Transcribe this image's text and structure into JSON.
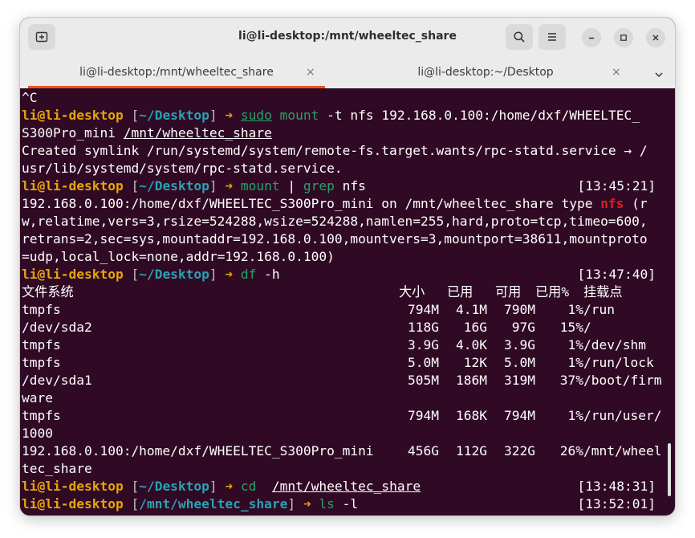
{
  "window": {
    "title": "li@li-desktop:/mnt/wheeltec_share"
  },
  "tabs": [
    {
      "label": "li@li-desktop:/mnt/wheeltec_share",
      "close": "×",
      "active": true
    },
    {
      "label": "li@li-desktop:~/Desktop",
      "close": "×",
      "active": false
    }
  ],
  "colors": {
    "accent": "#e95420",
    "terminal_bg": "#300a24",
    "prompt_user": "#e5a50a",
    "prompt_path": "#2aa1b3",
    "command": "#26a269"
  },
  "terminal": {
    "lines": [
      {
        "t": "^C"
      },
      {
        "user": "li@li-desktop",
        "open": " [",
        "path": "~/Desktop",
        "close": "]",
        "arrow": " ➜ ",
        "cmd": "sudo mount",
        "args": " -t nfs 192.168.0.100:/home/dxf/WHEELTEC_"
      },
      {
        "t": "S300Pro_mini ",
        "u": "/mnt/wheeltec_share"
      },
      {
        "t": "Created symlink /run/systemd/system/remote-fs.target.wants/rpc-statd.service → /"
      },
      {
        "t": "usr/lib/systemd/system/rpc-statd.service."
      },
      {
        "user": "li@li-desktop",
        "open": " [",
        "path": "~/Desktop",
        "close": "]",
        "arrow": " ➜ ",
        "cmd": "mount",
        "args": " | ",
        "cmd2": "grep",
        "args2": " nfs",
        "time": "[13:45:21]"
      },
      {
        "t": "192.168.0.100:/home/dxf/WHEELTEC_S300Pro_mini on /mnt/wheeltec_share type ",
        "red": "nfs",
        "t2": " (r"
      },
      {
        "t": "w,relatime,vers=3,rsize=524288,wsize=524288,namlen=255,hard,proto=tcp,timeo=600,"
      },
      {
        "t": "retrans=2,sec=sys,mountaddr=192.168.0.100,mountvers=3,mountport=38611,mountproto"
      },
      {
        "t": "=udp,local_lock=none,addr=192.168.0.100)"
      },
      {
        "user": "li@li-desktop",
        "open": " [",
        "path": "~/Desktop",
        "close": "]",
        "arrow": " ➜ ",
        "cmd": "df",
        "args": " -h",
        "time": "[13:47:40]"
      },
      {
        "df": [
          "文件系统",
          "大小",
          "已用",
          "可用",
          "已用%",
          "挂载点"
        ]
      },
      {
        "df": [
          "tmpfs",
          "794M",
          "4.1M",
          "790M",
          "1%",
          "/run"
        ]
      },
      {
        "df": [
          "/dev/sda2",
          "118G",
          "16G",
          "97G",
          "15%",
          "/"
        ]
      },
      {
        "df": [
          "tmpfs",
          "3.9G",
          "4.0K",
          "3.9G",
          "1%",
          "/dev/shm"
        ]
      },
      {
        "df": [
          "tmpfs",
          "5.0M",
          "12K",
          "5.0M",
          "1%",
          "/run/lock"
        ]
      },
      {
        "df": [
          "/dev/sda1",
          "505M",
          "186M",
          "319M",
          "37%",
          "/boot/firm"
        ]
      },
      {
        "t": "ware"
      },
      {
        "df": [
          "tmpfs",
          "794M",
          "168K",
          "794M",
          "1%",
          "/run/user/"
        ]
      },
      {
        "t": "1000"
      },
      {
        "df": [
          "192.168.0.100:/home/dxf/WHEELTEC_S300Pro_mini",
          "456G",
          "112G",
          "322G",
          "26%",
          "/mnt/wheel"
        ]
      },
      {
        "t": "tec_share"
      },
      {
        "user": "li@li-desktop",
        "open": " [",
        "path": "~/Desktop",
        "close": "]",
        "arrow": " ➜ ",
        "cmd": "cd",
        "args": "  ",
        "u": "/mnt/wheeltec_share",
        "time": "[13:48:31]"
      },
      {
        "user": "li@li-desktop",
        "open": " [",
        "path": "/mnt/wheeltec_share",
        "close": "]",
        "arrow": " ➜ ",
        "cmd": "ls",
        "args": " -l",
        "time": "[13:52:01]"
      }
    ]
  }
}
